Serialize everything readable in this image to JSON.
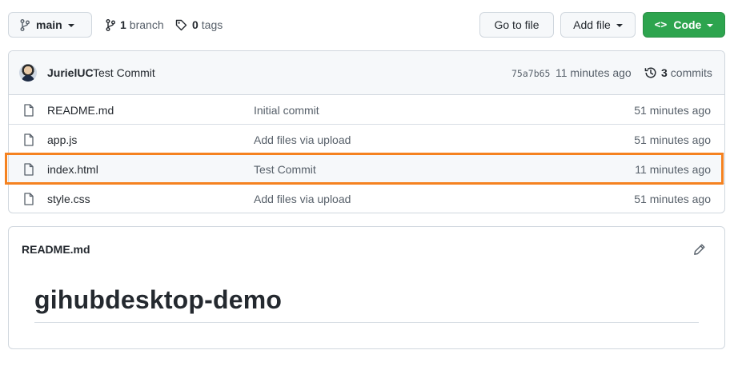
{
  "toolbar": {
    "branch_name": "main",
    "branch_count": "1",
    "branch_label": "branch",
    "tag_count": "0",
    "tag_label": "tags",
    "go_to_file_label": "Go to file",
    "add_file_label": "Add file",
    "code_label": "Code",
    "code_button_color": "#2da44e"
  },
  "latest_commit": {
    "author": "JurielUC",
    "message": "Test Commit",
    "sha": "75a7b65",
    "time": "11 minutes ago",
    "commit_count": "3",
    "commit_label": "commits"
  },
  "files": [
    {
      "name": "README.md",
      "commit_message": "Initial commit",
      "age": "51 minutes ago"
    },
    {
      "name": "app.js",
      "commit_message": "Add files via upload",
      "age": "51 minutes ago"
    },
    {
      "name": "index.html",
      "commit_message": "Test Commit",
      "age": "11 minutes ago"
    },
    {
      "name": "style.css",
      "commit_message": "Add files via upload",
      "age": "51 minutes ago"
    }
  ],
  "highlight_color": "#f58220",
  "readme": {
    "filename": "README.md",
    "heading": "gihubdesktop-demo"
  }
}
